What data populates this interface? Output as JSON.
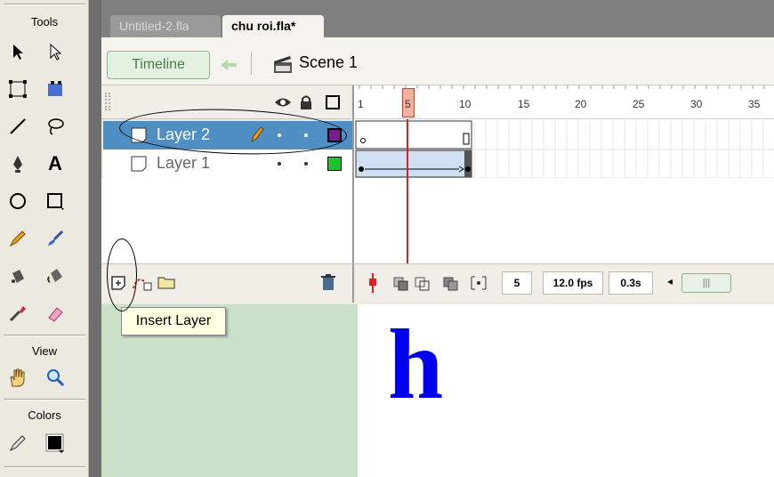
{
  "tools_panel": {
    "title": "Tools",
    "view_title": "View",
    "colors_title": "Colors"
  },
  "tabs": [
    {
      "label": "Untitled-2.fla"
    },
    {
      "label": "chu roi.fla*"
    }
  ],
  "scene_bar": {
    "timeline_label": "Timeline",
    "scene_label": "Scene 1"
  },
  "layers": [
    {
      "name": "Layer 2",
      "color": "#7b1c8c"
    },
    {
      "name": "Layer 1",
      "color": "#22c02a"
    }
  ],
  "frame_ruler": {
    "ticks": [
      "1",
      "5",
      "10",
      "15",
      "20",
      "25",
      "30",
      "35"
    ],
    "current_frame": 5
  },
  "timeline_status": {
    "frame": "5",
    "fps": "12.0 fps",
    "time": "0.3s"
  },
  "tooltip": "Insert Layer",
  "stage_text": "h",
  "colors": {
    "stage_text": "#0000ee",
    "layer_selected": "#4f8fc4",
    "playhead": "#e02020",
    "pasteboard": "#c9e1c9"
  }
}
